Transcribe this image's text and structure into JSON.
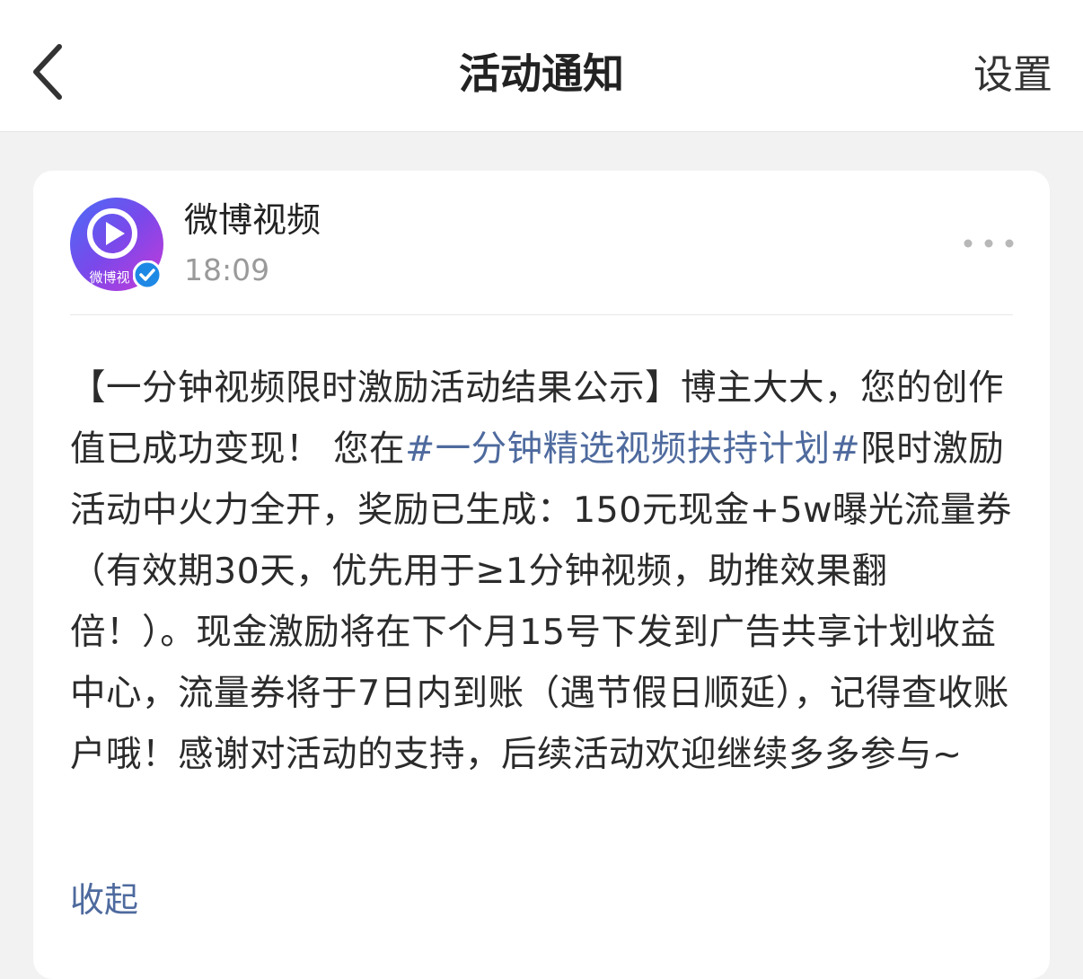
{
  "header": {
    "title": "活动通知",
    "settings_label": "设置",
    "back_icon": "chevron-left-icon"
  },
  "notification": {
    "sender": {
      "name": "微博视频",
      "time": "18:09",
      "avatar_label": "微博视",
      "verified_icon": "verified-check-icon",
      "avatar_color": "#6a4cf0"
    },
    "more_icon": "more-dots-icon",
    "message": {
      "part1": "【一分钟视频限时激励活动结果公示】博主大大，您的创作值已成功变现！ 您在",
      "tag": "#一分钟精选视频扶持计划#",
      "part2": "限时激励活动中火力全开，奖励已生成：150元现金+5w曝光流量券（有效期30天，优先用于≥1分钟视频，助推效果翻倍！）。现金激励将在下个月15号下发到广告共享计划收益中心，流量券将于7日内到账（遇节假日顺延），记得查收账户哦！感谢对活动的支持，后续活动欢迎继续多多参与~"
    },
    "collapse_label": "收起"
  },
  "colors": {
    "link": "#4e6a9e",
    "verified": "#1e88e5",
    "background": "#f2f2f2"
  }
}
